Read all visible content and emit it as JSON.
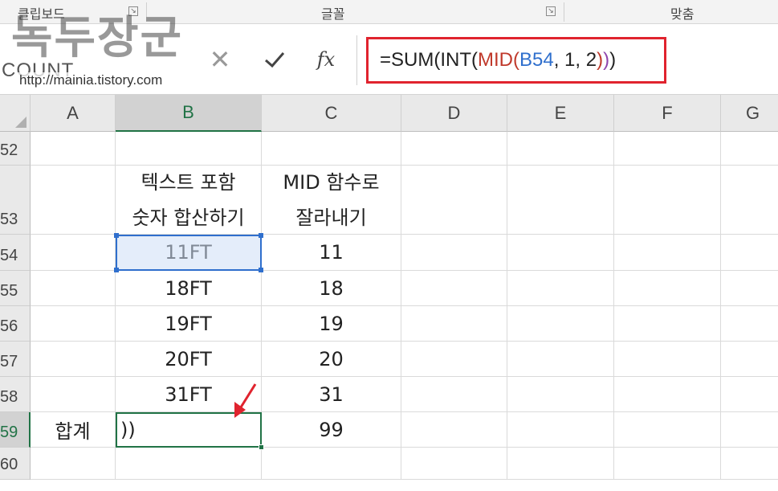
{
  "ribbon": {
    "groups": [
      {
        "label": "클립보드"
      },
      {
        "label": "글꼴"
      },
      {
        "label": "맞춤"
      }
    ]
  },
  "watermark": {
    "title": "녹두장군",
    "url": "http://mainia.tistory.com"
  },
  "formula_bar": {
    "name_box": "COUNT",
    "cancel_label": "✕",
    "fx_label": "fx",
    "formula_parts": [
      {
        "text": "=SUM(INT(",
        "color": "#222222"
      },
      {
        "text": "MID(",
        "color": "#c0392b"
      },
      {
        "text": "B54",
        "color": "#2f6fcd"
      },
      {
        "text": ", 1, 2",
        "color": "#222222"
      },
      {
        "text": ")",
        "color": "#c0392b"
      },
      {
        "text": ")",
        "color": "#8e44ad"
      },
      {
        "text": ")",
        "color": "#222222"
      }
    ],
    "highlight_color": "#e0232e"
  },
  "sheet": {
    "columns": [
      "A",
      "B",
      "C",
      "D",
      "E",
      "F",
      "G"
    ],
    "selected_column": "B",
    "rows": [
      {
        "num": "52",
        "A": "",
        "B": "",
        "C": ""
      },
      {
        "num": "53",
        "A": "",
        "B": [
          "텍스트 포함",
          "숫자 합산하기"
        ],
        "C": [
          "MID 함수로",
          "잘라내기"
        ]
      },
      {
        "num": "54",
        "A": "",
        "B": "11FT",
        "C": "11"
      },
      {
        "num": "55",
        "A": "",
        "B": "18FT",
        "C": "18"
      },
      {
        "num": "56",
        "A": "",
        "B": "19FT",
        "C": "19"
      },
      {
        "num": "57",
        "A": "",
        "B": "20FT",
        "C": "20"
      },
      {
        "num": "58",
        "A": "",
        "B": "31FT",
        "C": "31"
      },
      {
        "num": "59",
        "A": "합계",
        "B": "))",
        "C": "99"
      },
      {
        "num": "60",
        "A": "",
        "B": "",
        "C": ""
      }
    ],
    "selected_row": "59",
    "active_cell": "B59",
    "range_reference": "B54"
  },
  "annotation": {
    "arrow_color": "#e0232e"
  }
}
